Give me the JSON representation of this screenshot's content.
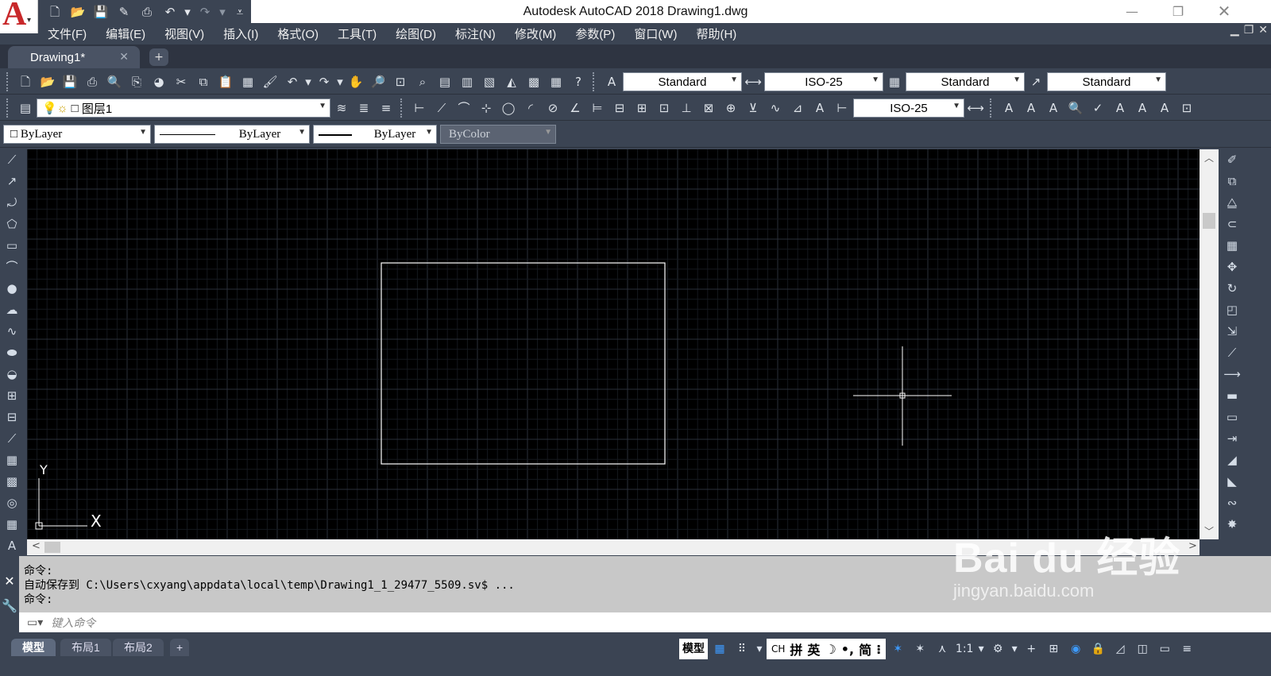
{
  "title_bar": {
    "app_logo": "A",
    "title": "Autodesk AutoCAD 2018    Drawing1.dwg",
    "quick_access": [
      "new-icon",
      "open-icon",
      "save-icon",
      "save-as-icon",
      "print-icon",
      "undo-icon",
      "redo-icon",
      "customize-icon"
    ]
  },
  "menu": [
    "文件(F)",
    "编辑(E)",
    "视图(V)",
    "插入(I)",
    "格式(O)",
    "工具(T)",
    "绘图(D)",
    "标注(N)",
    "修改(M)",
    "参数(P)",
    "窗口(W)",
    "帮助(H)"
  ],
  "tabs": {
    "active": "Drawing1*"
  },
  "styles_toolbar": {
    "text_style": "Standard",
    "dim_style": "ISO-25",
    "table_style": "Standard",
    "multileader_style": "Standard"
  },
  "layers_toolbar": {
    "current_layer": "图层1",
    "dim_style_2": "ISO-25"
  },
  "properties_toolbar": {
    "color": "ByLayer",
    "linetype": "ByLayer",
    "lineweight": "ByLayer",
    "plot_style": "ByColor"
  },
  "ucs": {
    "x_label": "X",
    "y_label": "Y"
  },
  "command_history": [
    "命令:",
    "自动保存到 C:\\Users\\cxyang\\appdata\\local\\temp\\Drawing1_1_29477_5509.sv$ ...",
    "命令:"
  ],
  "command_input": {
    "placeholder": "键入命令"
  },
  "layout_tabs": [
    "模型",
    "布局1",
    "布局2"
  ],
  "status": {
    "model_label": "模型",
    "ime_items": [
      "CH",
      "拼",
      "英",
      "简"
    ],
    "scale": "1:1"
  },
  "watermark": {
    "brand": "Bai du 经验",
    "url": "jingyan.baidu.com"
  }
}
